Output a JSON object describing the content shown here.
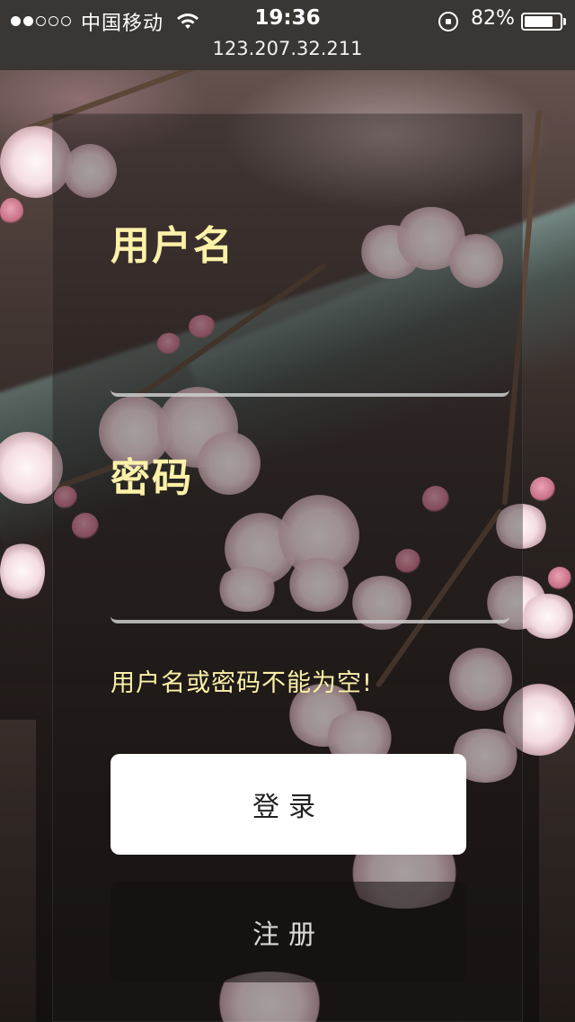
{
  "status_bar": {
    "carrier": "中国移动",
    "time": "19:36",
    "battery_percent_label": "82%",
    "battery_level": 0.82,
    "signal_bars_filled": 2,
    "signal_bars_total": 5
  },
  "browser": {
    "url": "123.207.32.211"
  },
  "login_form": {
    "username_label": "用户名",
    "username_value": "",
    "password_label": "密码",
    "password_value": "",
    "error_message": "用户名或密码不能为空!",
    "login_button": "登录",
    "register_button": "注册"
  },
  "colors": {
    "label_accent": "#fbf1a8",
    "status_bar_bg": "#3a3633"
  },
  "icons": [
    "wifi-icon",
    "rotation-lock-icon",
    "battery-icon"
  ]
}
